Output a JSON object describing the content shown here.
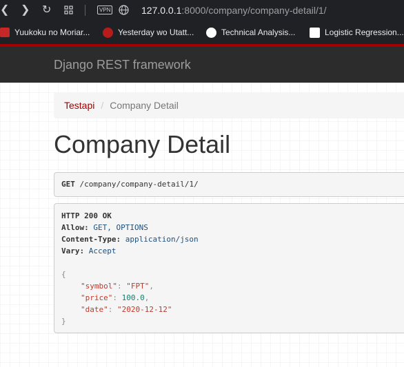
{
  "browser": {
    "url_host": "127.0.0.1",
    "url_rest": ":8000/company/company-detail/1/",
    "vpn_label": "VPN",
    "bookmarks": [
      {
        "label": "Yuukoku no Moriar..."
      },
      {
        "label": "Yesterday wo Utatt..."
      },
      {
        "label": "Technical Analysis..."
      },
      {
        "label": "Logistic Regression..."
      }
    ]
  },
  "navbar": {
    "brand": "Django REST framework"
  },
  "breadcrumb": {
    "link": "Testapi",
    "separator": "/",
    "active": "Company Detail"
  },
  "page": {
    "title": "Company Detail"
  },
  "request": {
    "method": "GET",
    "path": "/company/company-detail/1/"
  },
  "response": {
    "status": "HTTP 200 OK",
    "headers": [
      {
        "name": "Allow:",
        "value": "GET, OPTIONS"
      },
      {
        "name": "Content-Type:",
        "value": "application/json"
      },
      {
        "name": "Vary:",
        "value": "Accept"
      }
    ],
    "open_brace": "{",
    "close_brace": "}",
    "body": [
      {
        "key": "\"symbol\"",
        "sep": ": ",
        "value": "\"FPT\"",
        "tail": ","
      },
      {
        "key": "\"price\"",
        "sep": ": ",
        "value": "100.0",
        "tail": ","
      },
      {
        "key": "\"date\"",
        "sep": ": ",
        "value": "\"2020-12-12\"",
        "tail": ""
      }
    ]
  },
  "colors": {
    "accent": "#a30000",
    "navbar": "#2c2c2c",
    "browser_chrome": "#202124"
  }
}
